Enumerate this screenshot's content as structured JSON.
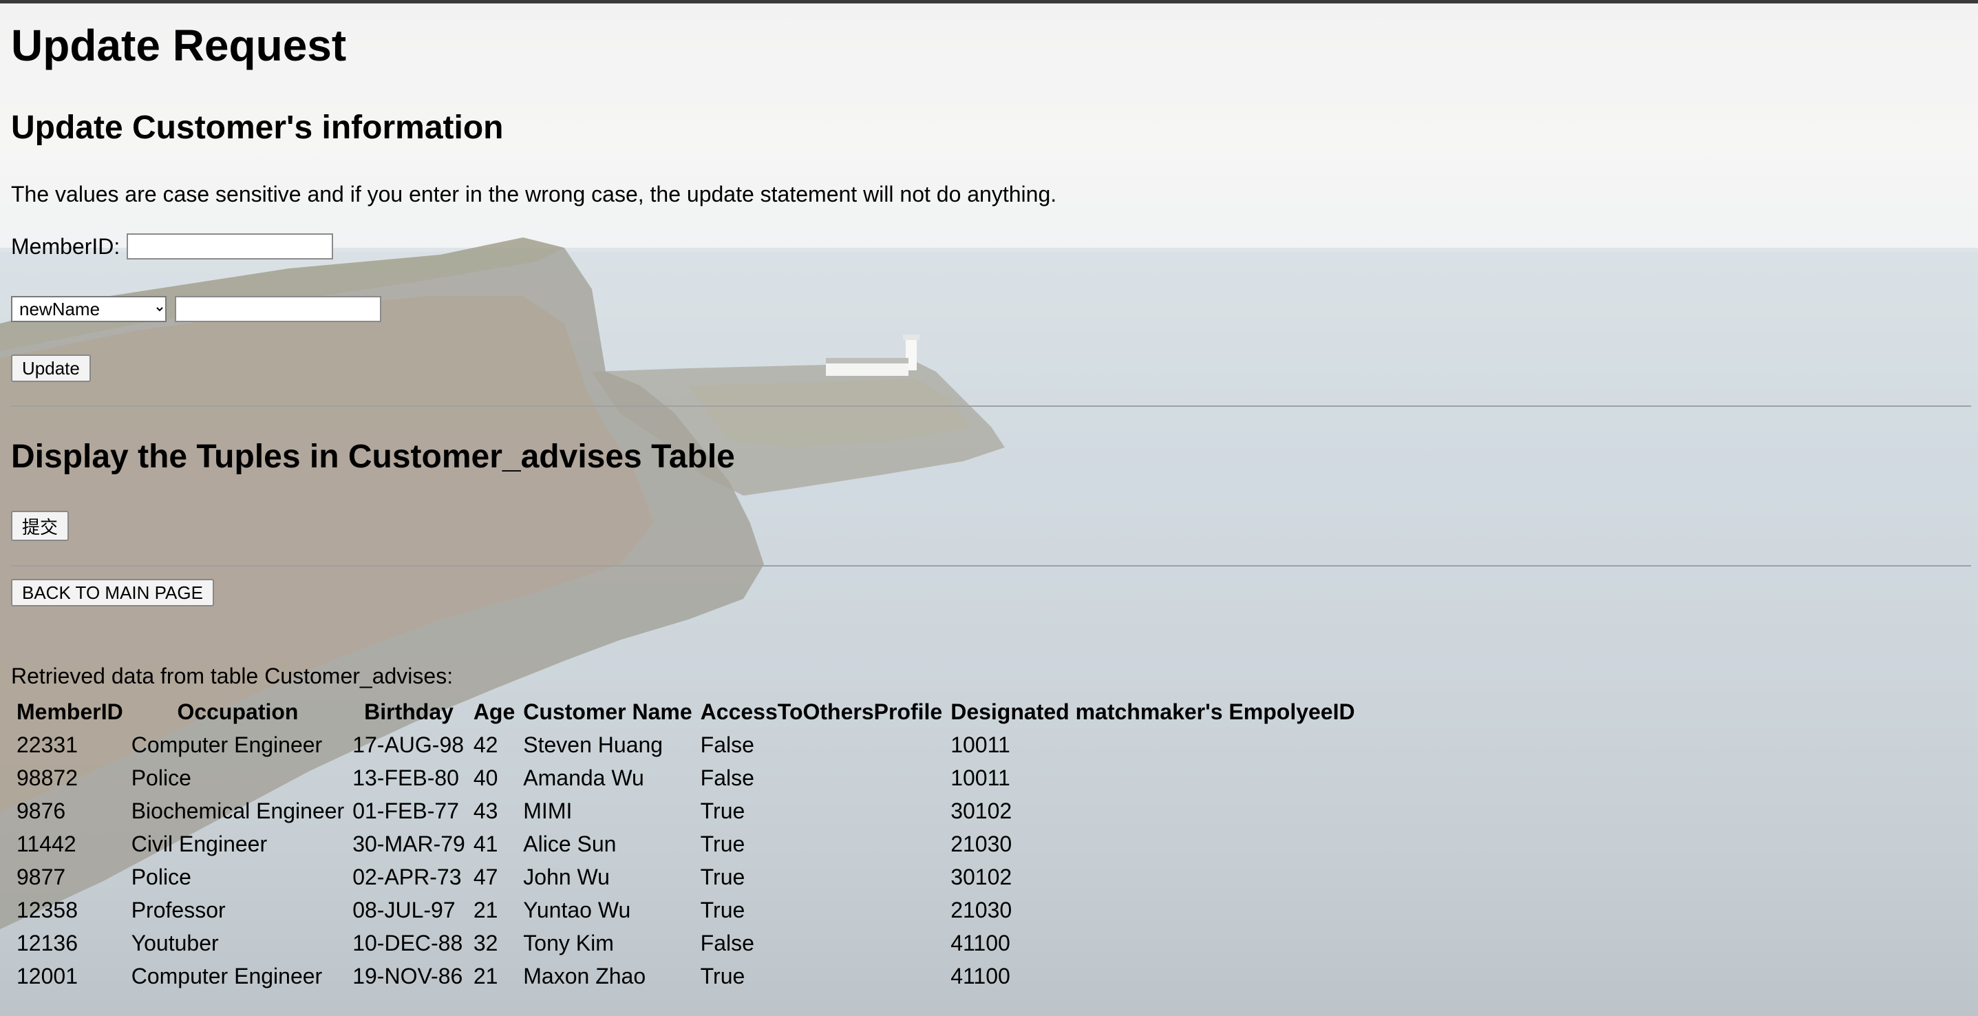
{
  "page": {
    "title": "Update Request",
    "update_section": {
      "heading": "Update Customer's information",
      "note": "The values are case sensitive and if you enter in the wrong case, the update statement will not do anything.",
      "memberid_label": "MemberID:",
      "memberid_value": "",
      "attribute_select": {
        "selected": "newName"
      },
      "new_value": "",
      "update_button": "Update"
    },
    "display_section": {
      "heading": "Display the Tuples in Customer_advises Table",
      "submit_button": "提交"
    },
    "back_button": "BACK TO MAIN PAGE",
    "retrieved_text": "Retrieved data from table Customer_advises:",
    "table": {
      "columns": [
        "MemberID",
        "Occupation",
        "Birthday",
        "Age",
        "Customer Name",
        "AccessToOthersProfile",
        "Designated matchmaker's EmpolyeeID"
      ],
      "rows": [
        [
          "22331",
          "Computer Engineer",
          "17-AUG-98",
          "42",
          "Steven Huang",
          "False",
          "10011"
        ],
        [
          "98872",
          "Police",
          "13-FEB-80",
          "40",
          "Amanda Wu",
          "False",
          "10011"
        ],
        [
          "9876",
          "Biochemical Engineer",
          "01-FEB-77",
          "43",
          "MIMI",
          "True",
          "30102"
        ],
        [
          "11442",
          "Civil Engineer",
          "30-MAR-79",
          "41",
          "Alice Sun",
          "True",
          "21030"
        ],
        [
          "9877",
          "Police",
          "02-APR-73",
          "47",
          "John Wu",
          "True",
          "30102"
        ],
        [
          "12358",
          "Professor",
          "08-JUL-97",
          "21",
          "Yuntao Wu",
          "True",
          "21030"
        ],
        [
          "12136",
          "Youtuber",
          "10-DEC-88",
          "32",
          "Tony Kim",
          "False",
          "41100"
        ],
        [
          "12001",
          "Computer Engineer",
          "19-NOV-86",
          "21",
          "Maxon Zhao",
          "True",
          "41100"
        ]
      ]
    }
  }
}
